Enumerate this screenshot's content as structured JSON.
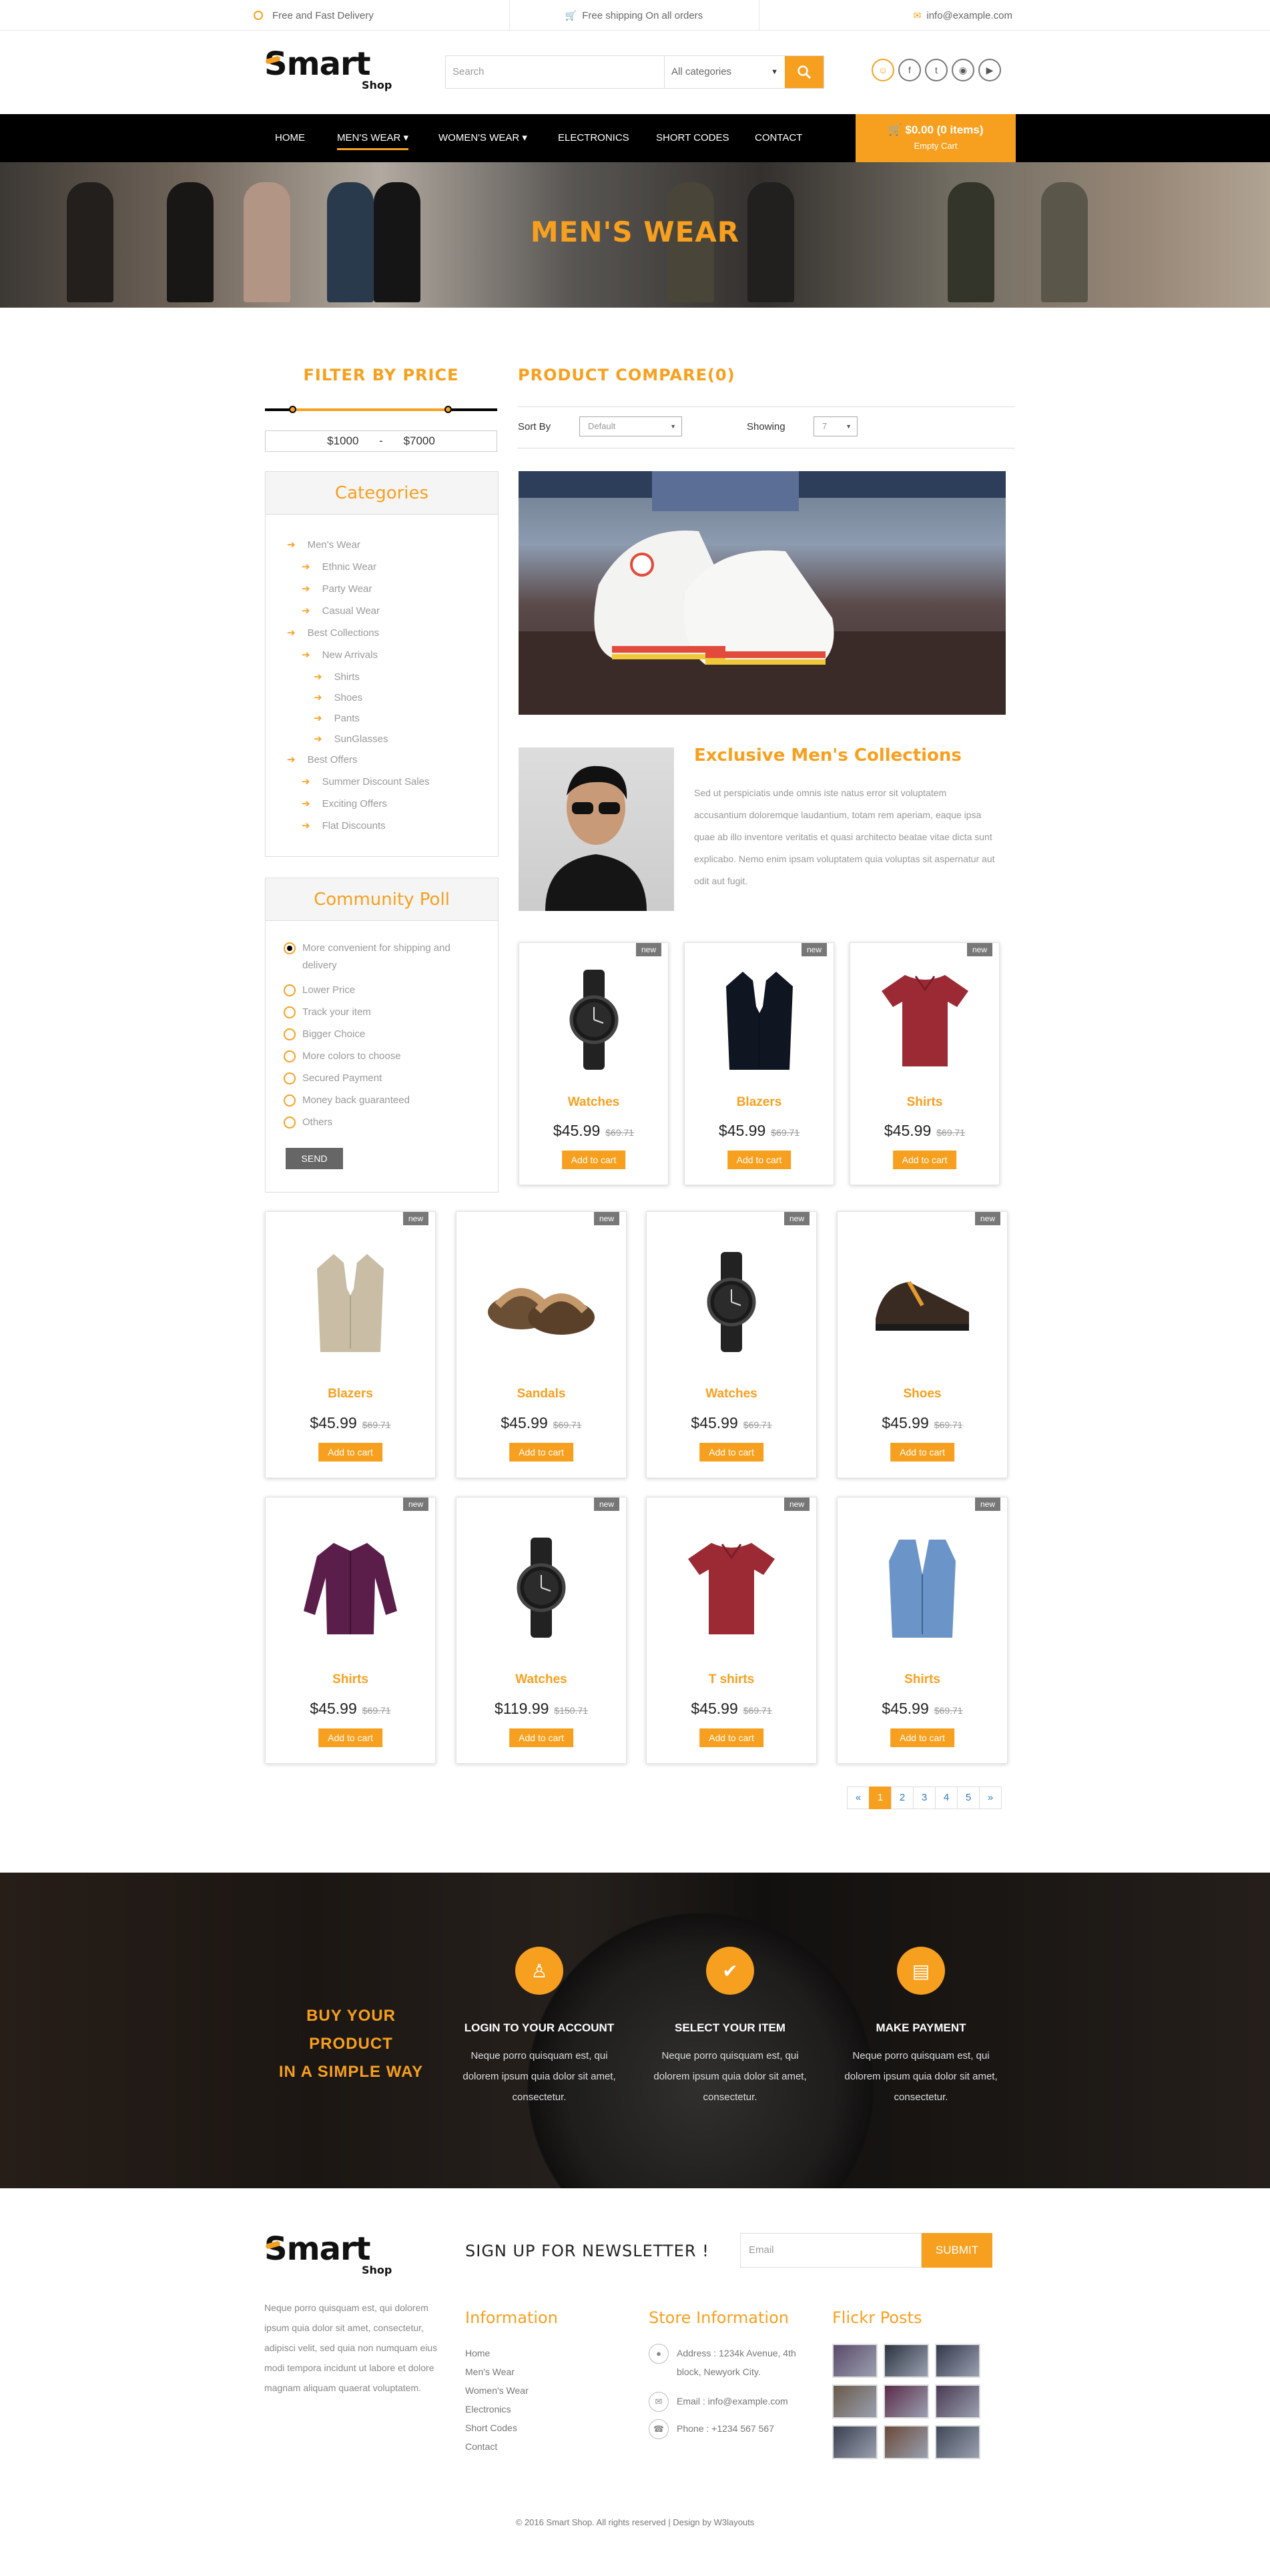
{
  "topbar": {
    "delivery": "Free and Fast Delivery",
    "shipping": "Free shipping On all orders",
    "email": "info@example.com"
  },
  "logo": {
    "main": "Smart",
    "sub": "Shop"
  },
  "search": {
    "placeholder": "Search",
    "category": "All categories"
  },
  "nav": {
    "items": [
      "HOME",
      "MEN'S WEAR ▾",
      "WOMEN'S WEAR ▾",
      "ELECTRONICS",
      "SHORT CODES",
      "CONTACT"
    ],
    "cart_total": "$0.00 (0 items)",
    "cart_empty": "Empty Cart"
  },
  "banner": {
    "title": "MEN'S WEAR"
  },
  "filter": {
    "title": "FILTER BY PRICE",
    "min": "$1000",
    "dash": "-",
    "max": "$7000"
  },
  "categories": {
    "title": "Categories",
    "items": [
      "Men's Wear",
      "Ethnic Wear",
      "Party Wear",
      "Casual Wear",
      "Best Collections",
      "New Arrivals",
      "Shirts",
      "Shoes",
      "Pants",
      "SunGlasses",
      "Best Offers",
      "Summer Discount Sales",
      "Exciting Offers",
      "Flat Discounts"
    ]
  },
  "poll": {
    "title": "Community Poll",
    "options": [
      "More convenient for shipping and delivery",
      "Lower Price",
      "Track your item",
      "Bigger Choice",
      "More colors to choose",
      "Secured Payment",
      "Money back guaranteed",
      "Others"
    ],
    "send": "SEND"
  },
  "compare": {
    "title": "PRODUCT COMPARE(0)",
    "sort_label": "Sort By",
    "sort_value": "Default",
    "showing_label": "Showing",
    "showing_value": "7"
  },
  "exclusive": {
    "title": "Exclusive Men's Collections",
    "text": "Sed ut perspiciatis unde omnis iste natus error sit voluptatem accusantium doloremque laudantium, totam rem aperiam, eaque ipsa quae ab illo inventore veritatis et quasi architecto beatae vitae dicta sunt explicabo. Nemo enim ipsam voluptatem quia voluptas sit aspernatur aut odit aut fugit."
  },
  "products": [
    {
      "name": "Watches",
      "price": "$45.99",
      "old": "$69.71",
      "badge": "new",
      "add": "Add to cart",
      "icon": "watch"
    },
    {
      "name": "Blazers",
      "price": "$45.99",
      "old": "$69.71",
      "badge": "new",
      "add": "Add to cart",
      "icon": "blazer"
    },
    {
      "name": "Shirts",
      "price": "$45.99",
      "old": "$69.71",
      "badge": "new",
      "add": "Add to cart",
      "icon": "tshirt"
    },
    {
      "name": "Blazers",
      "price": "$45.99",
      "old": "$69.71",
      "badge": "new",
      "add": "Add to cart",
      "icon": "blazer"
    },
    {
      "name": "Sandals",
      "price": "$45.99",
      "old": "$69.71",
      "badge": "new",
      "add": "Add to cart",
      "icon": "sandal"
    },
    {
      "name": "Watches",
      "price": "$45.99",
      "old": "$69.71",
      "badge": "new",
      "add": "Add to cart",
      "icon": "watch"
    },
    {
      "name": "Shoes",
      "price": "$45.99",
      "old": "$69.71",
      "badge": "new",
      "add": "Add to cart",
      "icon": "shoe"
    },
    {
      "name": "Shirts",
      "price": "$45.99",
      "old": "$69.71",
      "badge": "new",
      "add": "Add to cart",
      "icon": "shirt"
    },
    {
      "name": "Watches",
      "price": "$119.99",
      "old": "$150.71",
      "badge": "new",
      "add": "Add to cart",
      "icon": "watch"
    },
    {
      "name": "T shirts",
      "price": "$45.99",
      "old": "$69.71",
      "badge": "new",
      "add": "Add to cart",
      "icon": "tshirt"
    },
    {
      "name": "Shirts",
      "price": "$45.99",
      "old": "$69.71",
      "badge": "new",
      "add": "Add to cart",
      "icon": "vest"
    }
  ],
  "pagination": [
    "«",
    "1",
    "2",
    "3",
    "4",
    "5",
    "»"
  ],
  "steps": {
    "heading_1": "BUY YOUR PRODUCT",
    "heading_2": "IN A SIMPLE WAY",
    "items": [
      {
        "title": "LOGIN TO YOUR ACCOUNT",
        "text": "Neque porro quisquam est, qui dolorem ipsum quia dolor sit amet, consectetur."
      },
      {
        "title": "SELECT YOUR ITEM",
        "text": "Neque porro quisquam est, qui dolorem ipsum quia dolor sit amet, consectetur."
      },
      {
        "title": "MAKE PAYMENT",
        "text": "Neque porro quisquam est, qui dolorem ipsum quia dolor sit amet, consectetur."
      }
    ]
  },
  "footer": {
    "newsletter": "SIGN UP FOR NEWSLETTER !",
    "email_placeholder": "Email",
    "submit": "SUBMIT",
    "about": "Neque porro quisquam est, qui dolorem ipsum quia dolor sit amet, consectetur, adipisci velit, sed quia non numquam eius modi tempora incidunt ut labore et dolore magnam aliquam quaerat voluptatem.",
    "info_title": "Information",
    "info_links": [
      "Home",
      "Men's Wear",
      "Women's Wear",
      "Electronics",
      "Short Codes",
      "Contact"
    ],
    "store_title": "Store Information",
    "address": "Address : 1234k Avenue, 4th block, Newyork City.",
    "email": "Email : info@example.com",
    "phone": "Phone : +1234 567 567",
    "flickr_title": "Flickr Posts",
    "copyright": "© 2016 Smart Shop. All rights reserved | Design by W3layouts"
  },
  "colors": {
    "accent": "#f7a01f",
    "nav": "#000000"
  }
}
